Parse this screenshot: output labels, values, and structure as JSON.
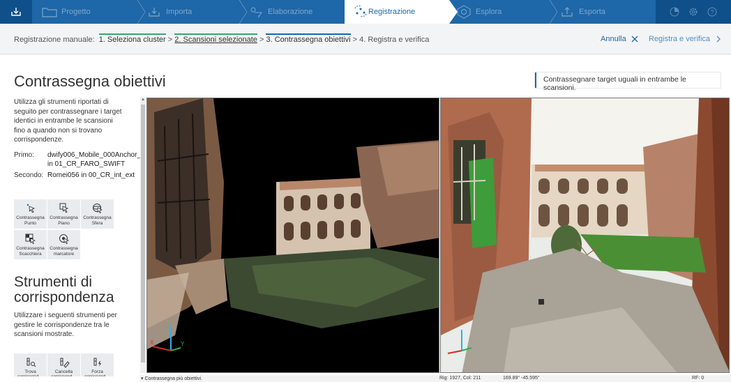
{
  "nav": {
    "steps": [
      "Progetto",
      "Importa",
      "Elaborazione",
      "Registrazione",
      "Esplora",
      "Esporta"
    ],
    "active": "Registrazione"
  },
  "breadcrumb": {
    "prefix": "Registrazione manuale:",
    "step1": "1. Seleziona cluster",
    "sep1": ">",
    "step2": "2. Scansioni selezionate",
    "sep2": ">",
    "step3": "3. Contrassegna obiettivi",
    "sep3": ">",
    "step4": "4. Registra e verifica",
    "cancel": "Annulla",
    "verify": "Registra e verifica"
  },
  "main": {
    "title": "Contrassegna obiettivi",
    "hint": "Contrassegnare target uguali in entrambe le scansioni."
  },
  "left": {
    "description": "Utilizza gli strumenti riportati di seguito per contrassegnare i target identici in entrambe le scansioni fino a quando non si trovano corrispondenze.",
    "first_label": "Primo:",
    "first_value": "dwify006_Mobile_000Anchor_ in 01_CR_FARO_SWIFT",
    "second_label": "Secondo:",
    "second_value": "Romei056 in 00_CR_int_ext",
    "tools": [
      {
        "label": "Contrassegna Punto",
        "icon": "point-icon"
      },
      {
        "label": "Contrassegna Piano",
        "icon": "plane-icon"
      },
      {
        "label": "Contrassegna Sfera",
        "icon": "sphere-icon"
      },
      {
        "label": "Contrassegna Scacchiera",
        "icon": "checkerboard-icon"
      },
      {
        "label": "Contrassegna marcatore",
        "icon": "marker-icon"
      }
    ],
    "corr_title": "Strumenti di corrispondenza",
    "corr_desc": "Utilizzare i seguenti strumenti per gestire le corrispondenze tra le scansioni mostrate.",
    "corr_tools": [
      {
        "label": "Trova corrispond…",
        "icon": "find-icon"
      },
      {
        "label": "Cancella corrispond…",
        "icon": "erase-icon"
      },
      {
        "label": "Forza corrispond…",
        "icon": "force-icon"
      }
    ]
  },
  "viewport": {
    "axis_z": "Z",
    "axis_y": "Y",
    "axis_x": "X"
  },
  "status": {
    "message": "▾ Contrassegna più obiettivi.",
    "rowcol": "Rig: 1927, Col: 211",
    "angles": "169.89° -45.595°",
    "rf": "RF: 0"
  }
}
